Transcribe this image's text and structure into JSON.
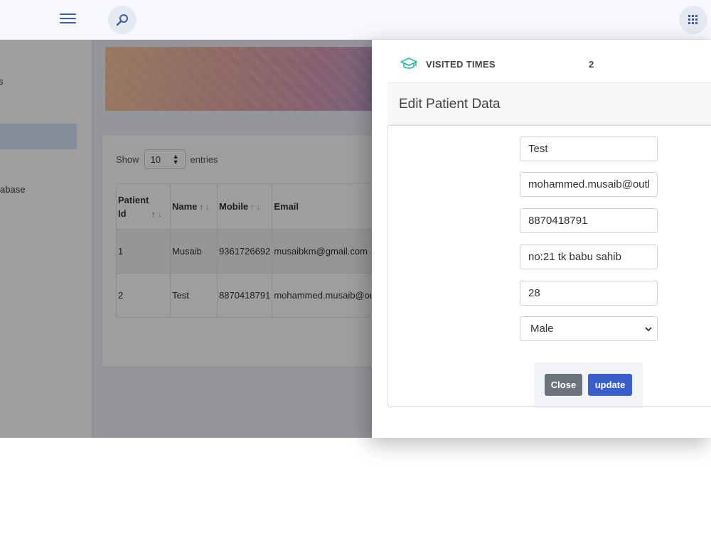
{
  "sidebar": {
    "items": [
      {
        "label": "s"
      },
      {
        "label": ""
      },
      {
        "label": "abase"
      }
    ]
  },
  "table": {
    "show_label": "Show",
    "entries_value": "10",
    "entries_label": "entries",
    "columns": [
      {
        "label": "Patient Id",
        "sort": "↑↓"
      },
      {
        "label": "Name",
        "sort": "↑↓"
      },
      {
        "label": "Mobile",
        "sort": "↑↓"
      },
      {
        "label": "Email",
        "sort": ""
      }
    ],
    "rows": [
      {
        "id": "1",
        "name": "Musaib",
        "mobile": "9361726692",
        "email": "musaibkm@gmail.com"
      },
      {
        "id": "2",
        "name": "Test",
        "mobile": "8870418791",
        "email": "mohammed.musaib@ou"
      }
    ]
  },
  "panel": {
    "visited_label": "VISITED TIMES",
    "visited_value": "2",
    "modal_title": "Edit Patient Data",
    "fields": {
      "name": "Test",
      "email": "mohammed.musaib@outl",
      "mobile": "8870418791",
      "address": "no:21 tk babu sahib",
      "age": "28",
      "gender": "Male"
    },
    "close_label": "Close",
    "update_label": "update"
  },
  "icons": {
    "menu": "hamburger-icon",
    "search": "search-icon",
    "apps": "grid-icon",
    "visited": "graduation-cap-icon"
  },
  "colors": {
    "accent": "#3a5fcd",
    "icon_blue": "#3f5aa9",
    "teal": "#25b8a6",
    "close_btn": "#6c737c"
  }
}
